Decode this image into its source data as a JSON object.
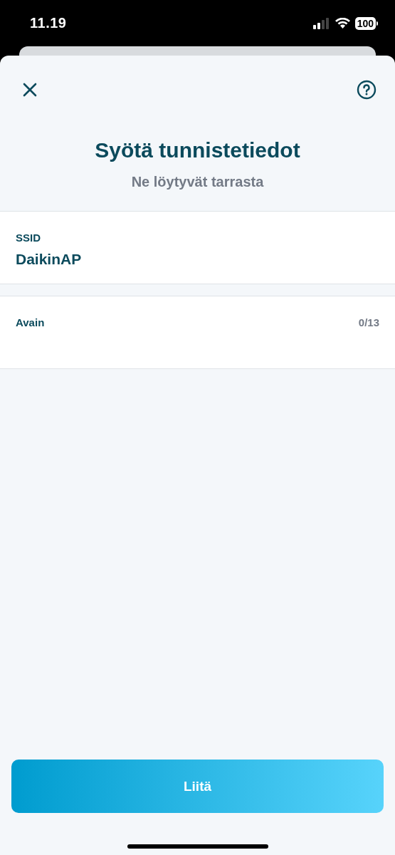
{
  "status_bar": {
    "time": "11.19",
    "battery": "100"
  },
  "header": {
    "title": "Syötä tunnistetiedot",
    "subtitle": "Ne löytyvät tarrasta"
  },
  "fields": [
    {
      "label": "SSID",
      "value": "DaikinAP"
    },
    {
      "label": "Avain",
      "counter": "0/13"
    }
  ],
  "button": {
    "label": "Liitä"
  }
}
